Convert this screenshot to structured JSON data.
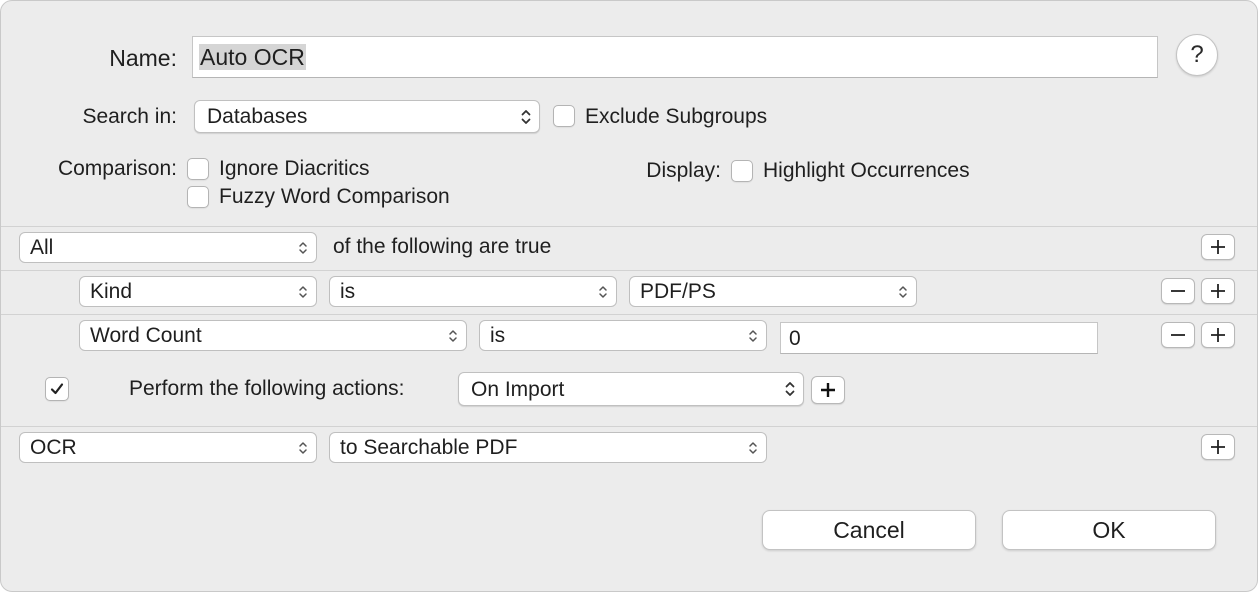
{
  "name_label": "Name:",
  "name_value": "Auto OCR",
  "help_label": "?",
  "search_in_label": "Search in:",
  "search_in_value": "Databases",
  "exclude_subgroups_label": "Exclude Subgroups",
  "comparison_label": "Comparison:",
  "ignore_diacritics_label": "Ignore Diacritics",
  "fuzzy_label": "Fuzzy Word Comparison",
  "display_label": "Display:",
  "highlight_label": "Highlight Occurrences",
  "match_mode": "All",
  "match_suffix": "of the following are true",
  "conditions": [
    {
      "field": "Kind",
      "operator": "is",
      "value": "PDF/PS"
    },
    {
      "field": "Word Count",
      "operator": "is",
      "value": "0"
    }
  ],
  "perform_label": "Perform the following actions:",
  "perform_trigger": "On Import",
  "action": {
    "type": "OCR",
    "option": "to Searchable PDF"
  },
  "cancel_label": "Cancel",
  "ok_label": "OK",
  "checkbox_states": {
    "exclude_subgroups": false,
    "ignore_diacritics": false,
    "fuzzy": false,
    "highlight": false,
    "perform_actions": true
  }
}
